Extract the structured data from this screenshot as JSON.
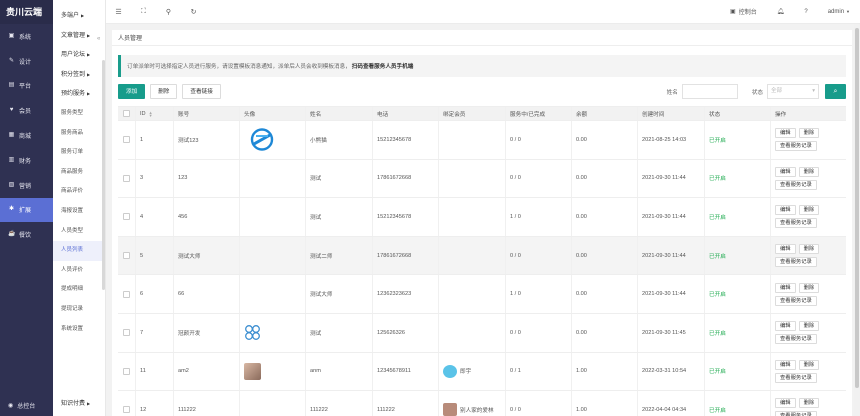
{
  "brand": "贵川云端",
  "sidebar": {
    "items": [
      {
        "label": "系统",
        "icon": "monitor-icon",
        "glyph": "▣"
      },
      {
        "label": "设计",
        "icon": "palette-icon",
        "glyph": "✎"
      },
      {
        "label": "平台",
        "icon": "platform-icon",
        "glyph": "▤"
      },
      {
        "label": "会员",
        "icon": "user-icon",
        "glyph": "♥"
      },
      {
        "label": "商城",
        "icon": "store-icon",
        "glyph": "▦"
      },
      {
        "label": "财务",
        "icon": "finance-icon",
        "glyph": "▥"
      },
      {
        "label": "营销",
        "icon": "marketing-icon",
        "glyph": "▧"
      },
      {
        "label": "扩展",
        "icon": "extension-icon",
        "glyph": "✱"
      },
      {
        "label": "餐饮",
        "icon": "food-icon",
        "glyph": "☕"
      }
    ],
    "active_index": 7,
    "footer": {
      "label": "总控台",
      "glyph": "◉"
    }
  },
  "subnav": {
    "items": [
      {
        "label": "多端户",
        "group": true,
        "caret": true
      },
      {
        "label": "文章管理",
        "group": true,
        "caret": true
      },
      {
        "label": "用户论坛",
        "group": true,
        "caret": true
      },
      {
        "label": "积分签到",
        "group": true,
        "caret": true
      },
      {
        "label": "预约服务",
        "group": true,
        "caret": true
      },
      {
        "label": "服务类型",
        "group": false
      },
      {
        "label": "服务商品",
        "group": false
      },
      {
        "label": "服务订单",
        "group": false
      },
      {
        "label": "商品服务",
        "group": false
      },
      {
        "label": "商品评价",
        "group": false
      },
      {
        "label": "海报设置",
        "group": false
      },
      {
        "label": "人员类型",
        "group": false
      },
      {
        "label": "人员列表",
        "group": false
      },
      {
        "label": "人员评价",
        "group": false
      },
      {
        "label": "提成明细",
        "group": false
      },
      {
        "label": "提现记录",
        "group": false
      },
      {
        "label": "系统设置",
        "group": false
      },
      {
        "label": "知识付费",
        "group": true,
        "caret": true
      }
    ],
    "active_index": 12
  },
  "header": {
    "dashboard": "控制台",
    "user": "admin"
  },
  "breadcrumb": "人员管理",
  "notice": {
    "text": "订单派单时可选择指定人员进行服务，请设置模板消息通知，派单后人员会收到模板消息，",
    "link": "扫码查看服务人员手机端"
  },
  "toolbar": {
    "add": "添加",
    "delete": "删除",
    "view_link": "查看链接",
    "name_label": "姓名",
    "status_label": "状态",
    "status_placeholder": "全部"
  },
  "table": {
    "columns": [
      "ID",
      "账号",
      "头像",
      "姓名",
      "电话",
      "绑定会员",
      "服务中/已完成",
      "余额",
      "创建时间",
      "状态",
      "操作"
    ],
    "rows": [
      {
        "id": "1",
        "account": "测试123",
        "avatar": "logo",
        "name": "小熊猫",
        "phone": "15212345678",
        "member": "",
        "service": "0 / 0",
        "balance": "0.00",
        "created": "2021-08-25 14:03",
        "status": "已开启"
      },
      {
        "id": "3",
        "account": "123",
        "avatar": "",
        "name": "测试",
        "phone": "17861672668",
        "member": "",
        "service": "0 / 0",
        "balance": "0.00",
        "created": "2021-09-30 11:44",
        "status": "已开启"
      },
      {
        "id": "4",
        "account": "456",
        "avatar": "",
        "name": "测试",
        "phone": "15212345678",
        "member": "",
        "service": "1 / 0",
        "balance": "0.00",
        "created": "2021-09-30 11:44",
        "status": "已开启"
      },
      {
        "id": "5",
        "account": "测试大师",
        "avatar": "",
        "name": "测试二师",
        "phone": "17861672668",
        "member": "",
        "service": "0 / 0",
        "balance": "0.00",
        "created": "2021-09-30 11:44",
        "status": "已开启"
      },
      {
        "id": "6",
        "account": "66",
        "avatar": "",
        "name": "测试大师",
        "phone": "12362323623",
        "member": "",
        "service": "1 / 0",
        "balance": "0.00",
        "created": "2021-09-30 11:44",
        "status": "已开启"
      },
      {
        "id": "7",
        "account": "冠颜开发",
        "avatar": "flower",
        "name": "测试",
        "phone": "125626326",
        "member": "",
        "service": "0 / 0",
        "balance": "0.00",
        "created": "2021-09-30 11:45",
        "status": "已开启"
      },
      {
        "id": "11",
        "account": "am2",
        "avatar": "photo",
        "name": "anm",
        "phone": "12345678911",
        "member": "即宇",
        "member_avatar": "cloud",
        "service": "0 / 1",
        "balance": "1.00",
        "created": "2022-03-31 10:54",
        "status": "已开启"
      },
      {
        "id": "12",
        "account": "111222",
        "avatar": "",
        "name": "111222",
        "phone": "111222",
        "member": "别人家的爱林",
        "member_avatar": "photo",
        "service": "0 / 0",
        "balance": "1.00",
        "created": "2022-04-04 04:34",
        "status": "已开启"
      }
    ],
    "highlight_index": 3,
    "ops": {
      "edit": "编辑",
      "delete": "删除",
      "records": "查看服务记录"
    }
  }
}
